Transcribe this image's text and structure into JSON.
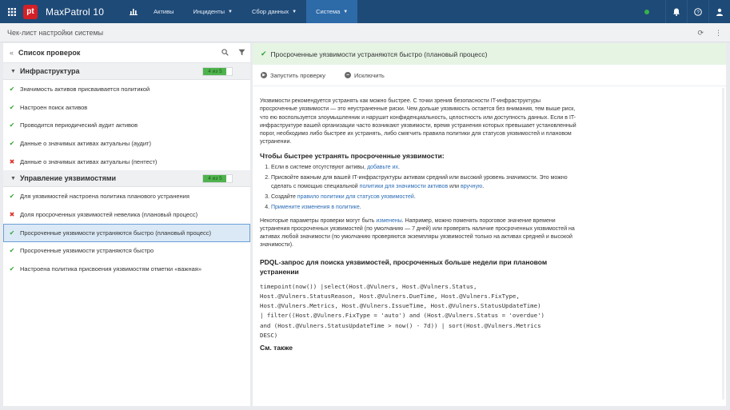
{
  "topbar": {
    "logo": "pt",
    "product": "MaxPatrol 10",
    "nav": [
      {
        "label": "Активы",
        "dropdown": false,
        "active": false
      },
      {
        "label": "Инциденты",
        "dropdown": true,
        "active": false
      },
      {
        "label": "Сбор данных",
        "dropdown": true,
        "active": false
      },
      {
        "label": "Система",
        "dropdown": true,
        "active": true
      }
    ],
    "status_color": "#38b249"
  },
  "page": {
    "title": "Чек-лист настройки системы"
  },
  "left": {
    "title": "Список проверок",
    "groups": [
      {
        "name": "Инфраструктура",
        "progress_text": "4 из 5",
        "progress": 0.8,
        "items": [
          {
            "label": "Значимость активов присваивается политикой",
            "status": "ok"
          },
          {
            "label": "Настроен поиск активов",
            "status": "ok"
          },
          {
            "label": "Проводится периодический аудит активов",
            "status": "ok"
          },
          {
            "label": "Данные о значимых активах актуальны (аудит)",
            "status": "ok"
          },
          {
            "label": "Данные о значимых активах актуальны (пентест)",
            "status": "fail"
          }
        ]
      },
      {
        "name": "Управление уязвимостями",
        "progress_text": "4 из 5",
        "progress": 0.8,
        "items": [
          {
            "label": "Для уязвимостей настроена политика планового устранения",
            "status": "ok"
          },
          {
            "label": "Доля просроченных уязвимостей невелика (плановый процесс)",
            "status": "fail"
          },
          {
            "label": "Просроченные уязвимости устраняются быстро (плановый процесс)",
            "status": "ok",
            "selected": true
          },
          {
            "label": "Просроченные уязвимости устраняются быстро",
            "status": "ok"
          },
          {
            "label": "Настроена политика присвоения уязвимостям отметки «важная»",
            "status": "ok"
          }
        ]
      }
    ]
  },
  "right": {
    "title": "Просроченные уязвимости устраняются быстро (плановый процесс)",
    "run_label": "Запустить проверку",
    "exclude_label": "Исключить",
    "intro": "Уязвимости рекомендуется устранять как можно быстрее. С точки зрения безопасности IT-инфраструктуры просроченные уязвимости — это неустраненные риски. Чем дольше уязвимость остается без внимания, тем выше риск, что ею воспользуется злоумышленник и нарушит конфиденциальность, целостность или доступность данных. Если в IT-инфраструктуре вашей организации часто возникают уязвимости, время устранения которых превышает установленный порог, необходимо либо быстрее их устранять, либо смягчить правила политики для статусов уязвимостей и плановом устранении.",
    "steps_heading": "Чтобы быстрее устранять просроченные уязвимости:",
    "step1_text": "Если в системе отсутствуют активы, ",
    "step1_link": "добавьте их",
    "step1_end": ".",
    "step2_text": "Присвойте важным для вашей IT-инфраструктуры активам средний или высокий уровень значимости. Это можно сделать с помощью специальной ",
    "step2_link1": "политики для значимости активов",
    "step2_mid": " или ",
    "step2_link2": "вручную",
    "step2_end": ".",
    "step3_text": "Создайте ",
    "step3_link": "правило политики для статусов уязвимостей",
    "step3_end": ".",
    "step4_link": "Примените изменения в политике",
    "step4_end": ".",
    "params_text1": "Некоторые параметры проверки могут быть ",
    "params_link": "изменены",
    "params_text2": ". Например, можно поменять пороговое значение времени устранения просроченных уязвимостей (по умолчанию — 7 дней) или проверять наличие просроченных уязвимостей на активах любой значимости (по умолчанию проверяются экземпляры уязвимостей только на активах средней и высокой значимости).",
    "pdql_heading": "PDQL-запрос для поиска уязвимостей, просроченных больше недели при плановом устранении",
    "pdql_code": "timepoint(now()) |select(Host.@Vulners, Host.@Vulners.Status,\nHost.@Vulners.StatusReason, Host.@Vulners.DueTime, Host.@Vulners.FixType,\nHost.@Vulners.Metrics, Host.@Vulners.IssueTime, Host.@Vulners.StatusUpdateTime)\n| filter((Host.@Vulners.FixType = 'auto') and (Host.@Vulners.Status = 'overdue')\nand (Host.@Vulners.StatusUpdateTime > now() - 7d)) | sort(Host.@Vulners.Metrics\nDESC)",
    "see_also": "См. также"
  }
}
